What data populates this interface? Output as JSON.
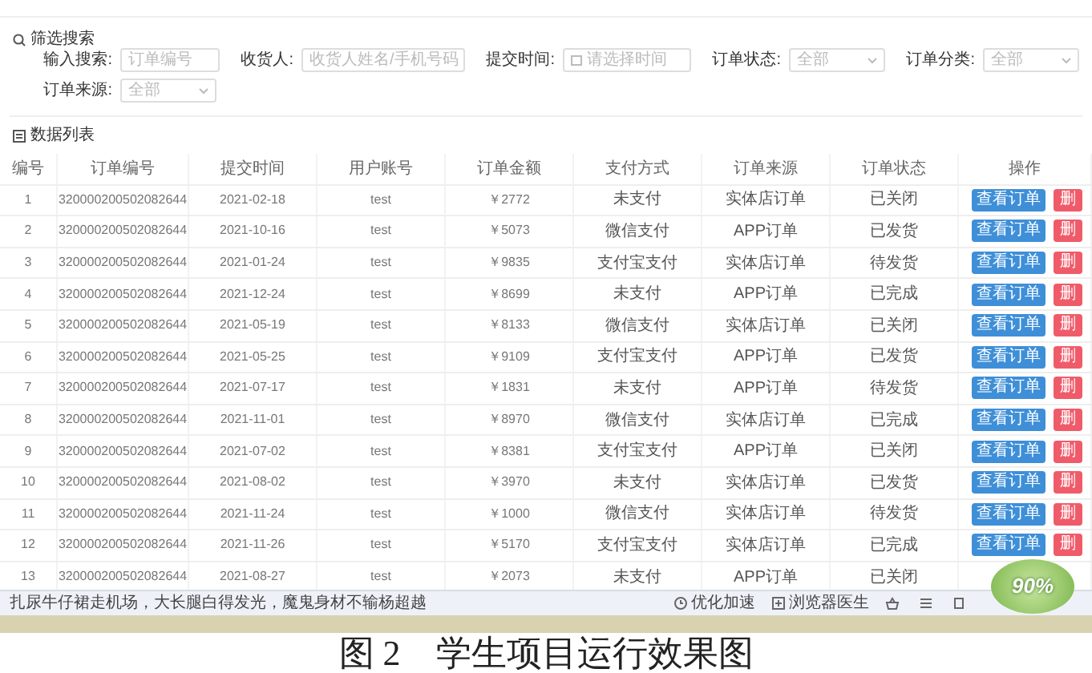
{
  "filter": {
    "title": "筛选搜索",
    "fields": [
      {
        "label": "输入搜索:",
        "kind": "input",
        "placeholder": "订单编号"
      },
      {
        "label": "收货人:",
        "kind": "input",
        "placeholder": "收货人姓名/手机号码"
      },
      {
        "label": "提交时间:",
        "kind": "date",
        "placeholder": "请选择时间"
      },
      {
        "label": "订单状态:",
        "kind": "select",
        "placeholder": "全部"
      },
      {
        "label": "订单分类:",
        "kind": "select",
        "placeholder": "全部"
      },
      {
        "label": "订单来源:",
        "kind": "select",
        "placeholder": "全部"
      }
    ]
  },
  "list": {
    "title": "数据列表",
    "columns": [
      "编号",
      "订单编号",
      "提交时间",
      "用户账号",
      "订单金额",
      "支付方式",
      "订单来源",
      "订单状态",
      "操作"
    ],
    "rows": [
      {
        "cells": [
          "1",
          "320000200502082644",
          "2021-02-18",
          "test",
          "￥2772",
          "未支付",
          "实体店订单",
          "已关闭"
        ],
        "actions": [
          "查看订单",
          "删"
        ]
      },
      {
        "cells": [
          "2",
          "320000200502082644",
          "2021-10-16",
          "test",
          "￥5073",
          "微信支付",
          "APP订单",
          "已发货"
        ],
        "actions": [
          "查看订单",
          "删"
        ]
      },
      {
        "cells": [
          "3",
          "320000200502082644",
          "2021-01-24",
          "test",
          "￥9835",
          "支付宝支付",
          "实体店订单",
          "待发货"
        ],
        "actions": [
          "查看订单",
          "删"
        ]
      },
      {
        "cells": [
          "4",
          "320000200502082644",
          "2021-12-24",
          "test",
          "￥8699",
          "未支付",
          "APP订单",
          "已完成"
        ],
        "actions": [
          "查看订单",
          "删"
        ]
      },
      {
        "cells": [
          "5",
          "320000200502082644",
          "2021-05-19",
          "test",
          "￥8133",
          "微信支付",
          "实体店订单",
          "已关闭"
        ],
        "actions": [
          "查看订单",
          "删"
        ]
      },
      {
        "cells": [
          "6",
          "320000200502082644",
          "2021-05-25",
          "test",
          "￥9109",
          "支付宝支付",
          "APP订单",
          "已发货"
        ],
        "actions": [
          "查看订单",
          "删"
        ]
      },
      {
        "cells": [
          "7",
          "320000200502082644",
          "2021-07-17",
          "test",
          "￥1831",
          "未支付",
          "APP订单",
          "待发货"
        ],
        "actions": [
          "查看订单",
          "删"
        ]
      },
      {
        "cells": [
          "8",
          "320000200502082644",
          "2021-11-01",
          "test",
          "￥8970",
          "微信支付",
          "实体店订单",
          "已完成"
        ],
        "actions": [
          "查看订单",
          "删"
        ]
      },
      {
        "cells": [
          "9",
          "320000200502082644",
          "2021-07-02",
          "test",
          "￥8381",
          "支付宝支付",
          "APP订单",
          "已关闭"
        ],
        "actions": [
          "查看订单",
          "删"
        ]
      },
      {
        "cells": [
          "10",
          "320000200502082644",
          "2021-08-02",
          "test",
          "￥3970",
          "未支付",
          "实体店订单",
          "已发货"
        ],
        "actions": [
          "查看订单",
          "删"
        ]
      },
      {
        "cells": [
          "11",
          "320000200502082644",
          "2021-11-24",
          "test",
          "￥1000",
          "微信支付",
          "实体店订单",
          "待发货"
        ],
        "actions": [
          "查看订单",
          "删"
        ]
      },
      {
        "cells": [
          "12",
          "320000200502082644",
          "2021-11-26",
          "test",
          "￥5170",
          "支付宝支付",
          "实体店订单",
          "已完成"
        ],
        "actions": [
          "查看订单",
          "删"
        ]
      },
      {
        "cells": [
          "13",
          "320000200502082644",
          "2021-08-27",
          "test",
          "￥2073",
          "未支付",
          "APP订单",
          "已关闭"
        ],
        "actions": []
      }
    ]
  },
  "status_bar": {
    "headline": "扎尿牛仔裙走机场，大长腿白得发光，魔鬼身材不输杨超越",
    "items": [
      {
        "kind": "speed",
        "label": "优化加速"
      },
      {
        "kind": "doctor",
        "label": "浏览器医生"
      }
    ]
  },
  "badge": {
    "text": "90%"
  },
  "caption": "图 2　学生项目运行效果图"
}
